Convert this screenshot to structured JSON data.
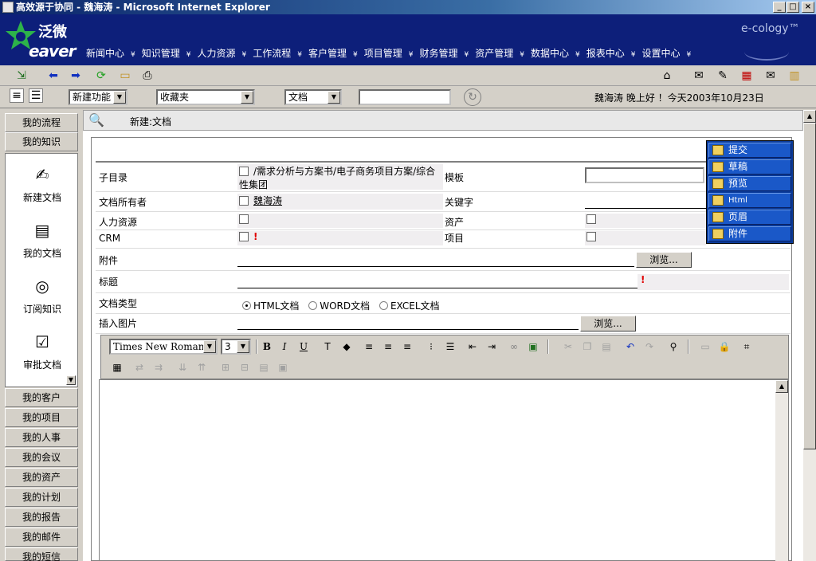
{
  "window": {
    "title": "高效源于协同 - 魏海涛 - Microsoft Internet Explorer",
    "buttons": [
      "_",
      "□",
      "×"
    ]
  },
  "banner": {
    "logo_cn": "泛微",
    "logo_en": "eaver",
    "brand": "e-cology™",
    "nav": [
      "新闻中心",
      "知识管理",
      "人力资源",
      "工作流程",
      "客户管理",
      "项目管理",
      "财务管理",
      "资产管理",
      "数据中心",
      "报表中心",
      "设置中心"
    ]
  },
  "toolbar2": {
    "new_function": "新建功能",
    "favorites": "收藏夹",
    "doc_type": "文档",
    "search_value": "",
    "greeting": "魏海涛 晚上好 ！今天2003年10月23日"
  },
  "sidebar": {
    "top_tabs": [
      "我的流程",
      "我的知识"
    ],
    "panel_items": [
      "新建文档",
      "我的文档",
      "订阅知识",
      "审批文档"
    ],
    "bottom_tabs": [
      "我的客户",
      "我的项目",
      "我的人事",
      "我的会议",
      "我的资产",
      "我的计划",
      "我的报告",
      "我的邮件",
      "我的短信"
    ]
  },
  "header": {
    "label": "新建:文档"
  },
  "form": {
    "subdir_label": "子目录",
    "subdir_value": "/需求分析与方案书/电子商务项目方案/综合性集团",
    "template_label": "模板",
    "owner_label": "文档所有者",
    "owner_value": "魏海涛",
    "keyword_label": "关键字",
    "hr_label": "人力资源",
    "asset_label": "资产",
    "crm_label": "CRM",
    "project_label": "项目",
    "attachment_label": "附件",
    "browse_label": "浏览...",
    "title_label": "标题",
    "doctype_label": "文档类型",
    "doctype_options": [
      "HTML文档",
      "WORD文档",
      "EXCEL文档"
    ],
    "insert_image_label": "插入图片",
    "required_mark": "!"
  },
  "actions": [
    "提交",
    "草稿",
    "预览",
    "Html",
    "页眉",
    "附件"
  ],
  "editor": {
    "font": "Times New Roman",
    "size": "3"
  }
}
